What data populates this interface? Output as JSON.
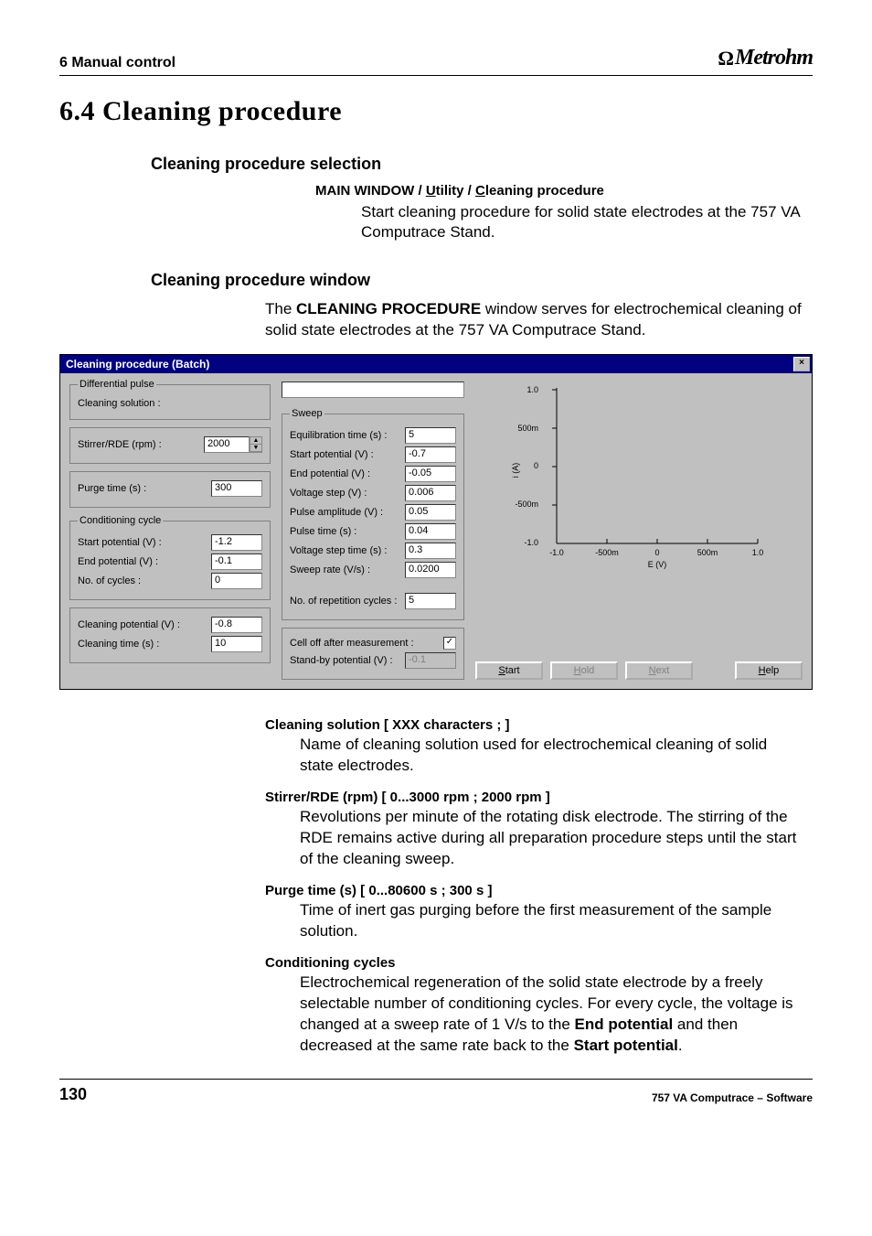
{
  "header": {
    "chapterLabel": "6  Manual control",
    "brand": "Metrohm"
  },
  "section": {
    "numberTitle": "6.4    Cleaning procedure",
    "sub1": "Cleaning procedure selection",
    "menuPath": "MAIN WINDOW / Utility / Cleaning procedure",
    "sub1Text": "Start cleaning procedure for solid state electrodes at the 757 VA Computrace Stand.",
    "sub2": "Cleaning procedure window",
    "sub2TextA": "The ",
    "sub2TextBold": "CLEANING PROCEDURE",
    "sub2TextB": " window serves for electrochemical cleaning of solid state electrodes at the 757 VA Computrace Stand."
  },
  "dialog": {
    "title": "Cleaning procedure (Batch)",
    "closeLabel": "×",
    "groups": {
      "dp": {
        "legend": "Differential pulse",
        "cleanSolLabel": "Cleaning solution :",
        "cleanSolValue": ""
      },
      "stir": {
        "label": "Stirrer/RDE (rpm) :",
        "value": "2000"
      },
      "purge": {
        "label": "Purge time (s) :",
        "value": "300"
      },
      "cond": {
        "legend": "Conditioning cycle",
        "startLabel": "Start potential (V) :",
        "startValue": "-1.2",
        "endLabel": "End potential (V) :",
        "endValue": "-0.1",
        "cyclesLabel": "No. of cycles :",
        "cyclesValue": "0"
      },
      "clean": {
        "potLabel": "Cleaning potential (V) :",
        "potValue": "-0.8",
        "timeLabel": "Cleaning time (s) :",
        "timeValue": "10"
      },
      "sweep": {
        "legend": "Sweep",
        "eqLabel": "Equilibration time (s) :",
        "eqValue": "5",
        "startLabel": "Start potential (V) :",
        "startValue": "-0.7",
        "endLabel": "End potential (V) :",
        "endValue": "-0.05",
        "vstepLabel": "Voltage step (V) :",
        "vstepValue": "0.006",
        "pampLabel": "Pulse amplitude (V) :",
        "pampValue": "0.05",
        "ptimeLabel": "Pulse time (s) :",
        "ptimeValue": "0.04",
        "vstLabel": "Voltage step time (s) :",
        "vstValue": "0.3",
        "srateLabel": "Sweep rate (V/s) :",
        "srateValue": "0.0200",
        "repLabel": "No. of repetition cycles :",
        "repValue": "5"
      },
      "bottom": {
        "cellOffLabel": "Cell off after measurement :",
        "cellOffChecked": "✓",
        "standbyLabel": "Stand-by potential (V) :",
        "standbyValue": "-0.1"
      }
    },
    "chart_data": {
      "type": "line",
      "title": "",
      "xlabel": "E (V)",
      "ylabel": "i (A)",
      "xlim": [
        -1.0,
        1.0
      ],
      "ylim": [
        -1.0,
        1.0
      ],
      "x_ticks": [
        "-1.0",
        "-500m",
        "0",
        "500m",
        "1.0"
      ],
      "y_ticks": [
        "-1.0",
        "-500m",
        "0",
        "500m",
        "1.0"
      ],
      "series": []
    },
    "buttons": {
      "start": "Start",
      "hold": "Hold",
      "next": "Next",
      "help": "Help"
    }
  },
  "params": {
    "p1": {
      "title": "Cleaning solution   [ XXX characters ;  ]",
      "desc": "Name of cleaning solution used for electrochemical cleaning of solid state electrodes."
    },
    "p2": {
      "title": "Stirrer/RDE (rpm)   [ 0...3000 rpm ; 2000 rpm ]",
      "desc": "Revolutions per minute of the rotating disk electrode. The stirring of the RDE remains active during all preparation procedure steps until the start of the cleaning sweep."
    },
    "p3": {
      "title": "Purge time (s)   [ 0...80600 s ; 300 s ]",
      "desc": "Time of inert gas purging before the first measurement of the sample solution."
    },
    "p4": {
      "title": "Conditioning cycles",
      "descA": "Electrochemical regeneration of the solid state electrode by a freely selectable number of conditioning cycles. For every cycle, the voltage is changed at a sweep rate of 1 V/s to the ",
      "b1": "End potential",
      "descB": " and then decreased at the same rate back to the ",
      "b2": "Start potential",
      "descC": "."
    }
  },
  "footer": {
    "pageNum": "130",
    "right": "757 VA Computrace – Software"
  }
}
